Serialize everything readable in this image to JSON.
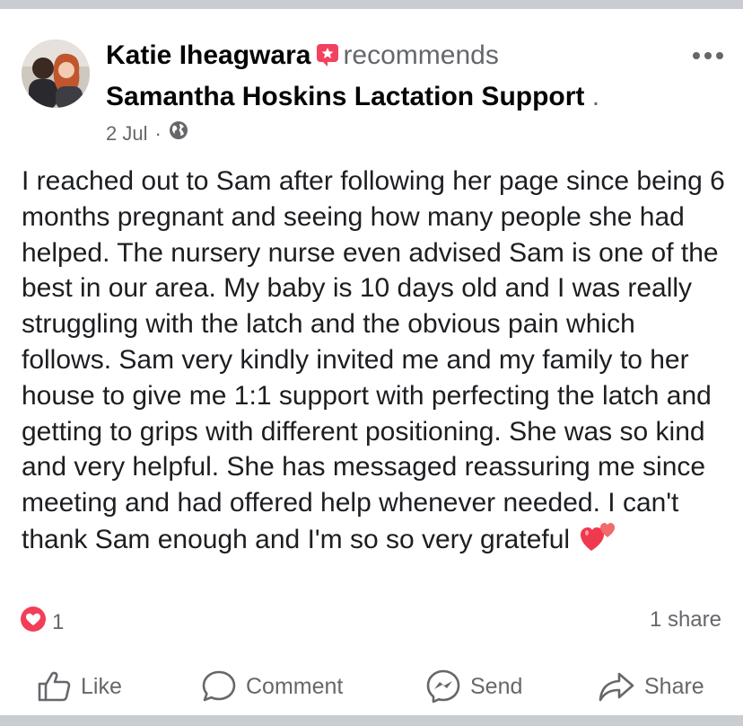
{
  "post": {
    "author": "Katie Iheagwara",
    "badge_icon": "recommendation-badge-icon",
    "verb": "recommends",
    "page_name": "Samantha Hoskins Lactation Support",
    "trailing_dot": ".",
    "date": "2 Jul",
    "separator": "·",
    "privacy_icon": "globe-icon",
    "body": "I reached out to Sam after following her page since being 6 months pregnant and seeing how many people she had helped. The nursery nurse even advised Sam is one of the best in our area. My baby is 10 days old and I was really struggling with the latch and the obvious pain which follows. Sam very kindly invited me and my family to her house to give me 1:1 support with perfecting the latch and getting to grips with different positioning. She was so kind and very helpful. She has messaged reassuring me since meeting and had offered help whenever needed. I can't thank Sam enough and I'm so so very grateful",
    "body_emoji_icon": "two-hearts-icon"
  },
  "reactions": {
    "icon": "love-reaction-icon",
    "count": "1",
    "shares": "1 share"
  },
  "actions": {
    "like": "Like",
    "comment": "Comment",
    "send": "Send",
    "share": "Share"
  },
  "colors": {
    "text_primary": "#050505",
    "text_secondary": "#65676b",
    "badge_red": "#f3425f",
    "love_red": "#f33e58",
    "background_gray": "#c9ccd1"
  }
}
